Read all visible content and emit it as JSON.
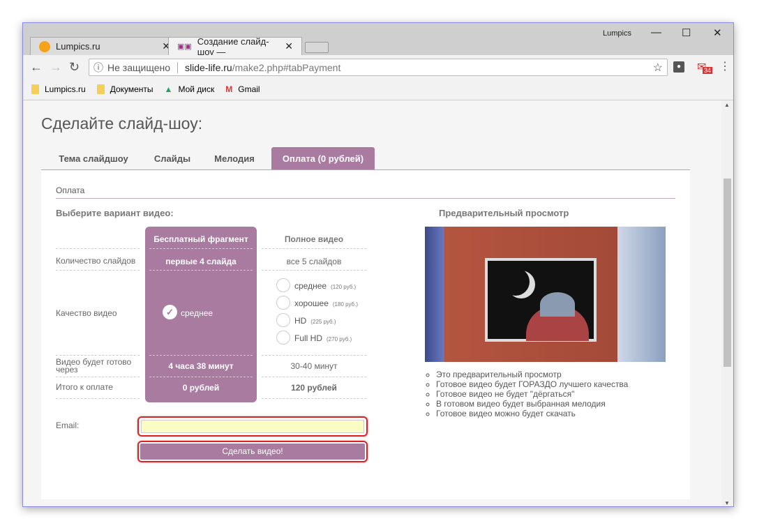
{
  "browser": {
    "tabs": [
      {
        "title": "Lumpics.ru",
        "icon": "orange-favicon"
      },
      {
        "title": "Создание слайд-шоу —",
        "icon": "slide-life-favicon",
        "active": true
      }
    ],
    "user": "Lumpics",
    "address": {
      "security": "Не защищено",
      "host": "slide-life.ru",
      "path": "/make2.php#tabPayment"
    },
    "bookmarks": [
      {
        "label": "Lumpics.ru",
        "icon": "folder-icon"
      },
      {
        "label": "Документы",
        "icon": "folder-icon"
      },
      {
        "label": "Мой диск",
        "icon": "google-drive-icon"
      },
      {
        "label": "Gmail",
        "icon": "gmail-icon"
      }
    ],
    "gmail_badge": "34"
  },
  "page": {
    "title": "Сделайте слайд-шоу:",
    "tabs": [
      "Тема слайдшоу",
      "Слайды",
      "Мелодия",
      "Оплата (0 рублей)"
    ],
    "active_tab": 3,
    "section": "Оплата",
    "choose_label": "Выберите вариант видео:",
    "preview_label": "Предварительный просмотр",
    "accent": "#a97ba1",
    "table": {
      "col_free": "Бесплатный фрагмент",
      "col_full": "Полное видео",
      "rows": [
        {
          "label": "Количество слайдов",
          "free": "первые 4 слайда",
          "full": "все 5 слайдов"
        },
        {
          "label": "Качество видео",
          "free": "среднее"
        },
        {
          "label": "Видео будет готово через",
          "free": "4 часа 38 минут",
          "full": "30-40 минут"
        },
        {
          "label": "Итого к оплате",
          "free": "0 рублей",
          "full": "120 рублей"
        }
      ],
      "quality_options": [
        {
          "label": "среднее",
          "price": "(120 руб.)"
        },
        {
          "label": "хорошее",
          "price": "(180 руб.)"
        },
        {
          "label": "HD",
          "price": "(225 руб.)"
        },
        {
          "label": "Full HD",
          "price": "(270 руб.)"
        }
      ]
    },
    "email_label": "Email:",
    "submit": "Сделать видео!",
    "preview_notes": [
      "Это предварительный просмотр",
      "Готовое видео будет ГОРАЗДО лучшего качества",
      "Готовое видео не будет \"дёргаться\"",
      "В готовом видео будет выбранная мелодия",
      "Готовое видео можно будет скачать"
    ]
  }
}
